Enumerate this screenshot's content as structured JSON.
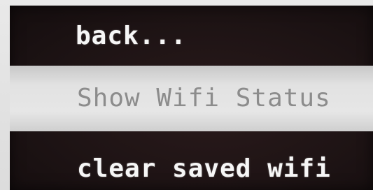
{
  "menu": {
    "items": [
      {
        "label": "back...",
        "selected": false
      },
      {
        "label": "Show Wifi Status",
        "selected": true
      },
      {
        "label": "clear saved wifi",
        "selected": false
      }
    ]
  },
  "colors": {
    "screen_background": "#1d1314",
    "text": "#f6f6f6",
    "highlight_background": "#e2e2e2",
    "highlight_text": "#8c8c8c"
  }
}
